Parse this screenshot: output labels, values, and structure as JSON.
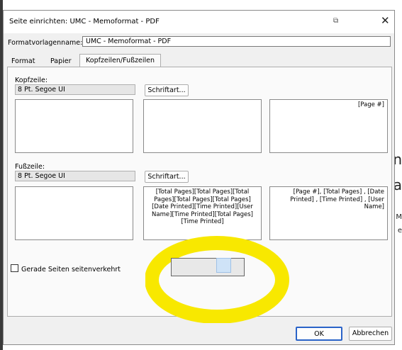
{
  "window": {
    "title": "Seite einrichten: UMC - Memoformat - PDF",
    "close_glyph": "✕",
    "pin_glyph": "⧉"
  },
  "formatvorlage": {
    "label": "Formatvorlagenname:",
    "value": "UMC - Memoformat - PDF"
  },
  "tabs": [
    {
      "label": "Format"
    },
    {
      "label": "Papier"
    },
    {
      "label": "Kopfzeilen/Fußzeilen"
    }
  ],
  "kopfzeile": {
    "label": "Kopfzeile:",
    "font": "8 Pt. Segoe UI",
    "font_button": "Schriftart...",
    "left": "",
    "center": "",
    "right": "[Page #]"
  },
  "fusszeile": {
    "label": "Fußzeile:",
    "font": "8 Pt. Segoe UI",
    "font_button": "Schriftart...",
    "left": "",
    "center": "[Total Pages][Total Pages][Total Pages][Total Pages][Total Pages][Date Printed][Time Printed][User Name][Time Printed][Total Pages][Time Printed]",
    "right": "[Page #], [Total Pages] , [Date Printed] , [Time Printed] , [User Name]"
  },
  "checkbox": {
    "label": "Gerade Seiten seitenverkehrt",
    "checked": false
  },
  "buttons": {
    "ok": "OK",
    "cancel": "Abbrechen"
  },
  "background": {
    "right_glyph_1": "n",
    "right_glyph_2": "a",
    "right_glyph_3": "M",
    "right_glyph_4": "e"
  },
  "colors": {
    "highlight": "#f8e800",
    "accent": "#2a63c8"
  }
}
